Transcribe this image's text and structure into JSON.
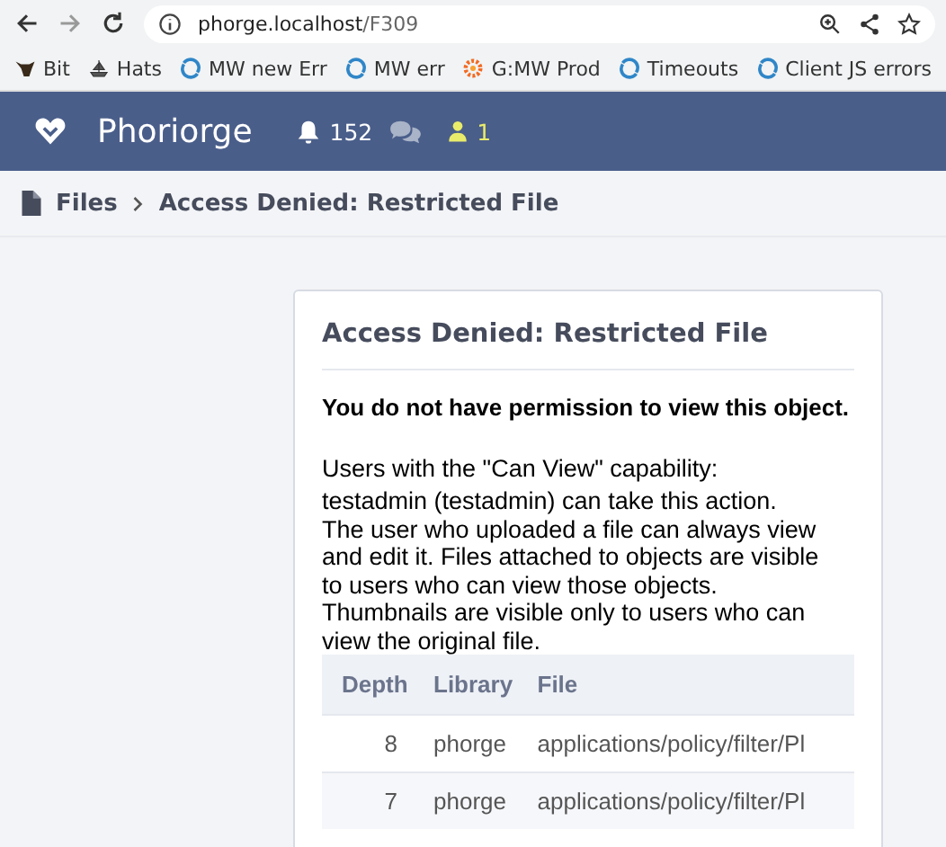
{
  "browser": {
    "url_host": "phorge.localhost",
    "url_path": "/F309",
    "bookmarks": [
      {
        "label": "Bit",
        "kind": "animal"
      },
      {
        "label": "Hats",
        "kind": "ship"
      },
      {
        "label": "MW new Err",
        "kind": "swirl"
      },
      {
        "label": "MW err",
        "kind": "swirl"
      },
      {
        "label": "G:MW Prod",
        "kind": "gear"
      },
      {
        "label": "Timeouts",
        "kind": "swirl"
      },
      {
        "label": "Client JS errors",
        "kind": "swirl"
      }
    ]
  },
  "navbar": {
    "brand": "Phoriorge",
    "notifications": "152",
    "people_count": "1"
  },
  "breadcrumbs": [
    {
      "label": "Files"
    },
    {
      "label": "Access Denied: Restricted File"
    }
  ],
  "panel": {
    "title": "Access Denied: Restricted File",
    "message": "You do not have permission to view this object.",
    "capability_heading": "Users with the \"Can View\" capability:",
    "capability_text": "testadmin (testadmin) can take this action.",
    "explanation": "The user who uploaded a file can always view and edit it. Files attached to objects are visible to users who can view those objects. Thumbnails are visible only to users who can view the original file.",
    "table": {
      "columns": [
        "Depth",
        "Library",
        "File"
      ],
      "rows": [
        {
          "depth": "8",
          "library": "phorge",
          "file": "applications/policy/filter/Pl"
        },
        {
          "depth": "7",
          "library": "phorge",
          "file": "applications/policy/filter/Pl"
        }
      ]
    }
  }
}
